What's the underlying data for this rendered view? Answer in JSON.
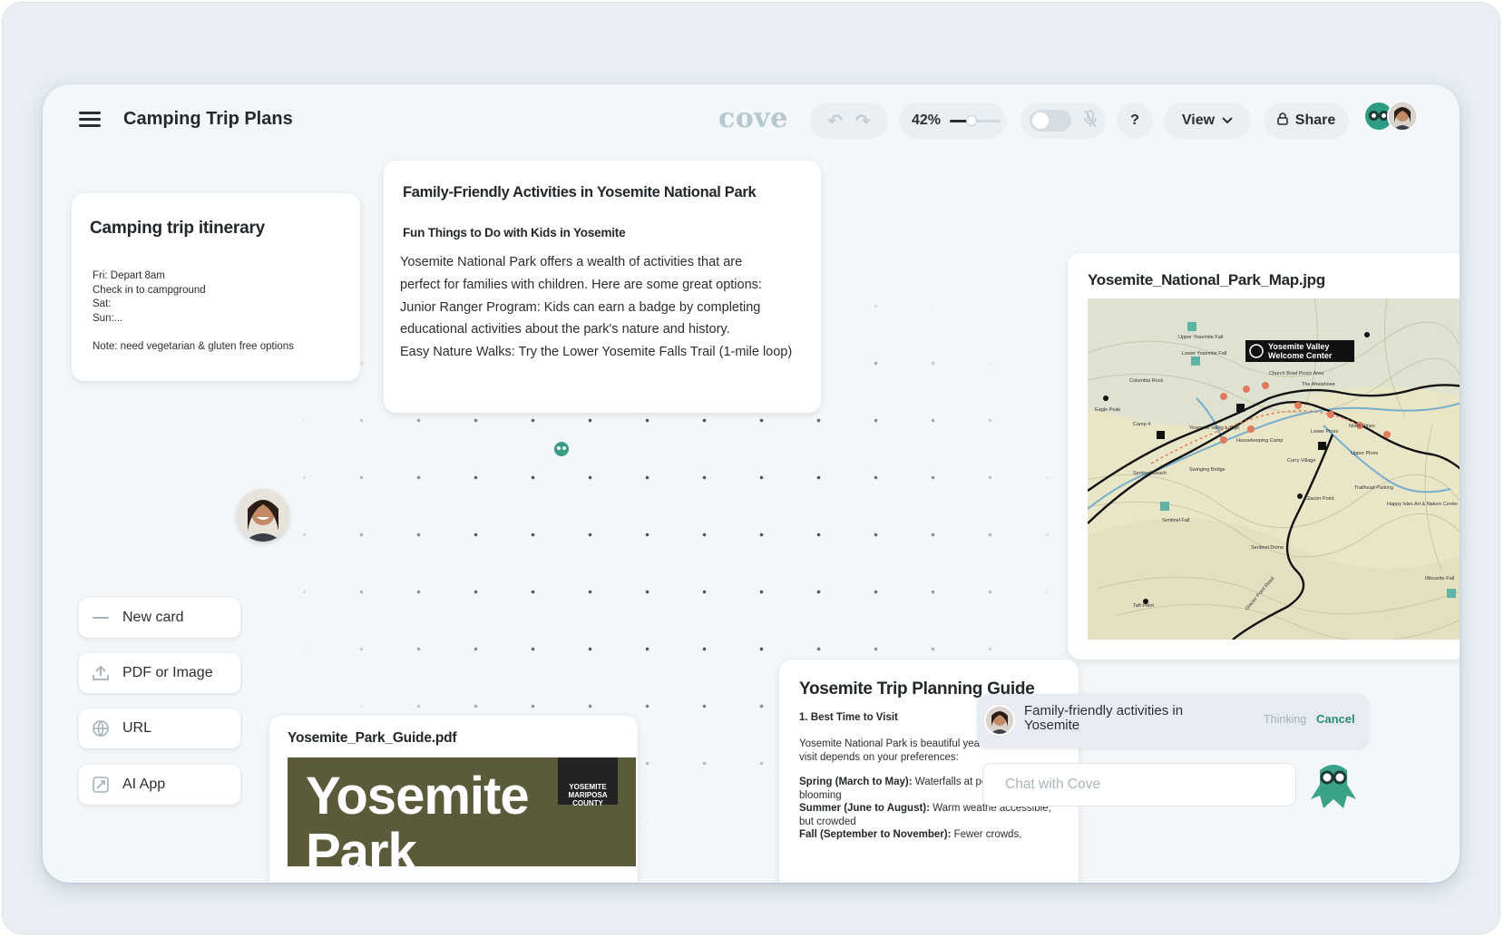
{
  "header": {
    "title": "Camping Trip Plans",
    "logo": "cove",
    "zoom_label": "42%",
    "zoom_level": 0.42,
    "help_label": "?",
    "view_label": "View",
    "share_label": "Share"
  },
  "itinerary_card": {
    "title": "Camping trip itinerary",
    "lines": [
      "Fri: Depart 8am",
      "Check in to campground",
      "Sat:",
      "Sun:...",
      "",
      "Note: need vegetarian & gluten free options"
    ]
  },
  "activities_card": {
    "title": "Family-Friendly Activities in Yosemite National Park",
    "subtitle": "Fun Things to Do with Kids in Yosemite",
    "lines": [
      "Yosemite National Park offers a wealth of activities that are",
      "perfect for families with children. Here are some great options:",
      "Junior Ranger Program: Kids can earn a badge by completing",
      "educational activities about the park's nature and history.",
      "Easy Nature Walks: Try the Lower Yosemite Falls Trail (1-mile loop)"
    ]
  },
  "map_card": {
    "title": "Yosemite_National_Park_Map.jpg",
    "callout": [
      "Yosemite Valley",
      "Welcome Center"
    ],
    "labels": [
      "Upper Yosemite Fall",
      "Lower Yosemite Fall",
      "Church Bowl Picnic Area",
      "The Ahwahnee",
      "Columbia Rock",
      "Eagle Peak",
      "Camp 4",
      "Yosemite Valley Lodge",
      "Housekeeping Camp",
      "Lower Pines",
      "North Pines",
      "Upper Pines",
      "Curry Village",
      "Sentinel Beach",
      "Swinging Bridge",
      "Glacier Point",
      "Trailhead Parking",
      "Happy Isles Art & Nature Center",
      "Sentinel Dome",
      "Taft Point",
      "Glacier Point Road",
      "Illilouette Fall",
      "Sentinel Fall"
    ]
  },
  "pdf_card": {
    "title": "Yosemite_Park_Guide.pdf",
    "cover_text": "Yosemite\nPark",
    "badge_text": "YOSEMITE MARIPOSA COUNTY"
  },
  "guide_card": {
    "title": "Yosemite Trip Planning Guide",
    "section": "1. Best Time to Visit",
    "intro": "Yosemite National Park is beautiful yea the best time to visit depends on your preferences:",
    "spring_label": "Spring (March to May):",
    "spring_text": " Waterfalls at pe wildflowers blooming",
    "summer_label": "Summer (June to August):",
    "summer_text": " Warm weathe accessible, but crowded",
    "fall_label": "Fall (September to November):",
    "fall_text": " Fewer crowds,"
  },
  "toolbar": {
    "new_card": "New card",
    "pdf_image": "PDF or Image",
    "url": "URL",
    "ai_app": "AI App"
  },
  "chat": {
    "query": "Family-friendly activities in Yosemite",
    "status": "Thinking",
    "cancel": "Cancel",
    "placeholder": "Chat with Cove"
  },
  "colors": {
    "accent": "#2e9c82",
    "background": "#f4f7f9",
    "pdf_cover": "#5b5a3a"
  },
  "icons": [
    "menu-icon",
    "undo-icon",
    "redo-icon",
    "microphone-icon",
    "chevron-down-icon",
    "lock-icon",
    "lines-icon",
    "upload-icon",
    "globe-icon",
    "ai-app-icon"
  ]
}
